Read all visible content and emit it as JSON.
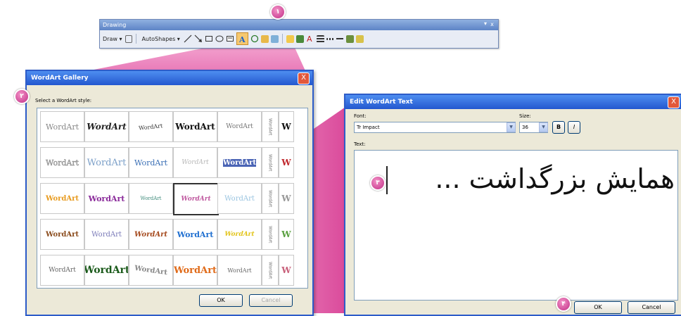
{
  "toolbar": {
    "title": "Drawing",
    "min_symbol": "▾",
    "close_symbol": "x",
    "draw_label": "Draw ▾",
    "autoshapes_label": "AutoShapes ▾",
    "badge": "۱"
  },
  "gallery": {
    "title": "WordArt Gallery",
    "close_symbol": "X",
    "prompt": "Select a WordArt style:",
    "badge": "۲",
    "styles": [
      [
        "WordArt",
        "WordArt",
        "WordArt",
        "WordArt",
        "WordArt"
      ],
      [
        "WordArt",
        "WordArt",
        "WordArt",
        "WordArt",
        "WordArt"
      ],
      [
        "WordArt",
        "WordArt",
        "WordArt",
        "WordArt",
        "WordArt"
      ],
      [
        "WordArt",
        "WordArt",
        "WordArt",
        "WordArt",
        "WordArt"
      ],
      [
        "WordArt",
        "WordArt",
        "WordArt",
        "WordArt",
        "WordArt"
      ]
    ],
    "side_styles": [
      "W",
      "W",
      "W",
      "W",
      "W"
    ],
    "ok_label": "OK",
    "cancel_label": "Cancel"
  },
  "edit": {
    "title": "Edit WordArt Text",
    "close_symbol": "X",
    "font_label": "Font:",
    "font_value": "Tr Impact",
    "size_label": "Size:",
    "size_value": "36",
    "bold_label": "B",
    "italic_label": "I",
    "text_label": "Text:",
    "text_value": "همایش بزرگداشت ...",
    "badge_text": "۳",
    "badge_ok": "۴",
    "ok_label": "OK",
    "cancel_label": "Cancel"
  },
  "colors": {
    "accent_pink": "#d63a93",
    "title_blue": "#2357cf"
  }
}
